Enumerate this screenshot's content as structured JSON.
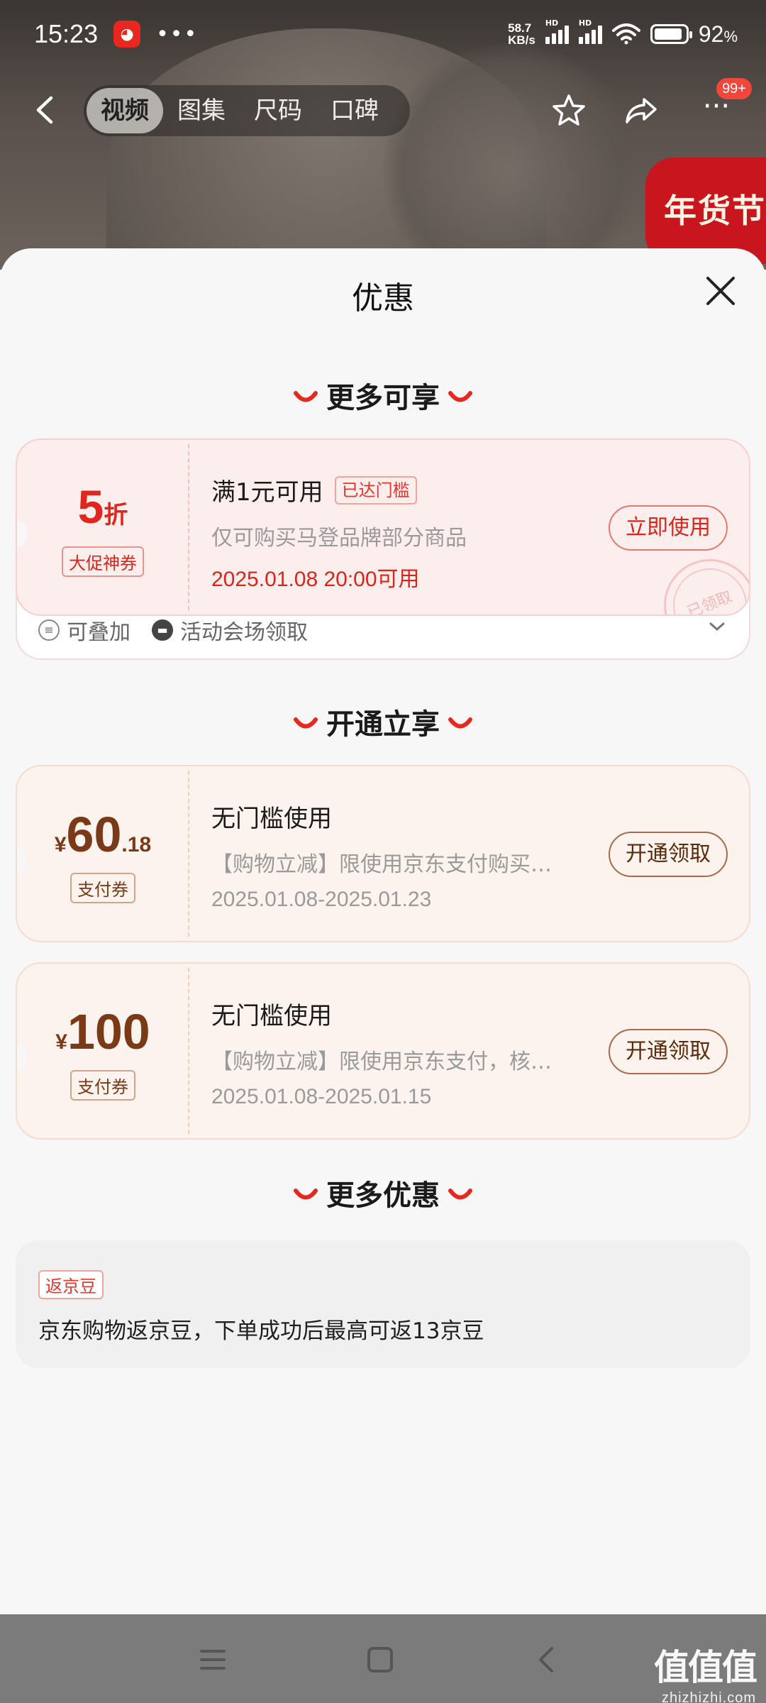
{
  "status": {
    "time": "15:23",
    "net_speed_top": "58.7",
    "net_speed_bottom": "KB/s",
    "sig1_label": "HD",
    "sig2_label": "HD",
    "battery_pct": "92",
    "battery_unit": "%",
    "battery_level": 0.92
  },
  "topnav": {
    "tabs": [
      "视频",
      "图集",
      "尺码",
      "口碑"
    ],
    "active_tab": 0,
    "badge": "99+",
    "more": "···"
  },
  "promo_label": "年货节",
  "sheet": {
    "title": "优惠"
  },
  "sections": {
    "more_enjoy": "更多可享",
    "open_enjoy": "开通立享",
    "more_offers": "更多优惠"
  },
  "coupons": [
    {
      "amount_main": "5",
      "amount_unit": "折",
      "tag": "大促神券",
      "title": "满1元可用",
      "badge": "已达门槛",
      "desc": "仅可购买马登品牌部分商品",
      "date": "2025.01.08 20:00可用",
      "button": "立即使用",
      "stamp": "已领取",
      "foot_stack": "可叠加",
      "foot_venue": "活动会场领取"
    },
    {
      "currency": "¥",
      "amount_main": "60",
      "amount_decimal": ".18",
      "tag": "支付券",
      "title": "无门槛使用",
      "desc": "【购物立减】限使用京东支付购买部分商品",
      "date": "2025.01.08-2025.01.23",
      "button": "开通领取"
    },
    {
      "currency": "¥",
      "amount_main": "100",
      "tag": "支付券",
      "title": "无门槛使用",
      "desc": "【购物立减】限使用京东支付，核卡后可用",
      "date": "2025.01.08-2025.01.15",
      "button": "开通领取"
    }
  ],
  "bean": {
    "tag": "返京豆",
    "text": "京东购物返京豆，下单成功后最高可返13京豆"
  },
  "watermark": {
    "main": "值值值",
    "domain": "zhizhizhi.com"
  },
  "colors": {
    "accent_red": "#d9261c",
    "coupon_brown": "#7b3a17"
  }
}
